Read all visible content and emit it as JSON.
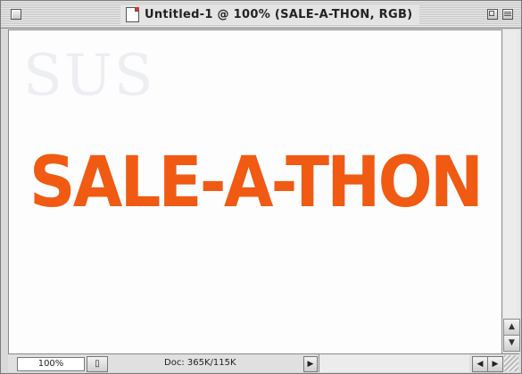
{
  "window": {
    "title": "Untitled-1 @ 100% (SALE-A-THON, RGB)"
  },
  "canvas": {
    "headline": "SALE-A-THON",
    "ghost_text": "SUS"
  },
  "statusbar": {
    "zoom": "100%",
    "doc_size": "Doc: 365K/115K"
  },
  "icons": {
    "close": "close-box-icon",
    "document": "document-icon",
    "zoom": "zoom-box-icon",
    "collapse": "collapse-box-icon"
  },
  "colors": {
    "headline": "#f15a13"
  }
}
